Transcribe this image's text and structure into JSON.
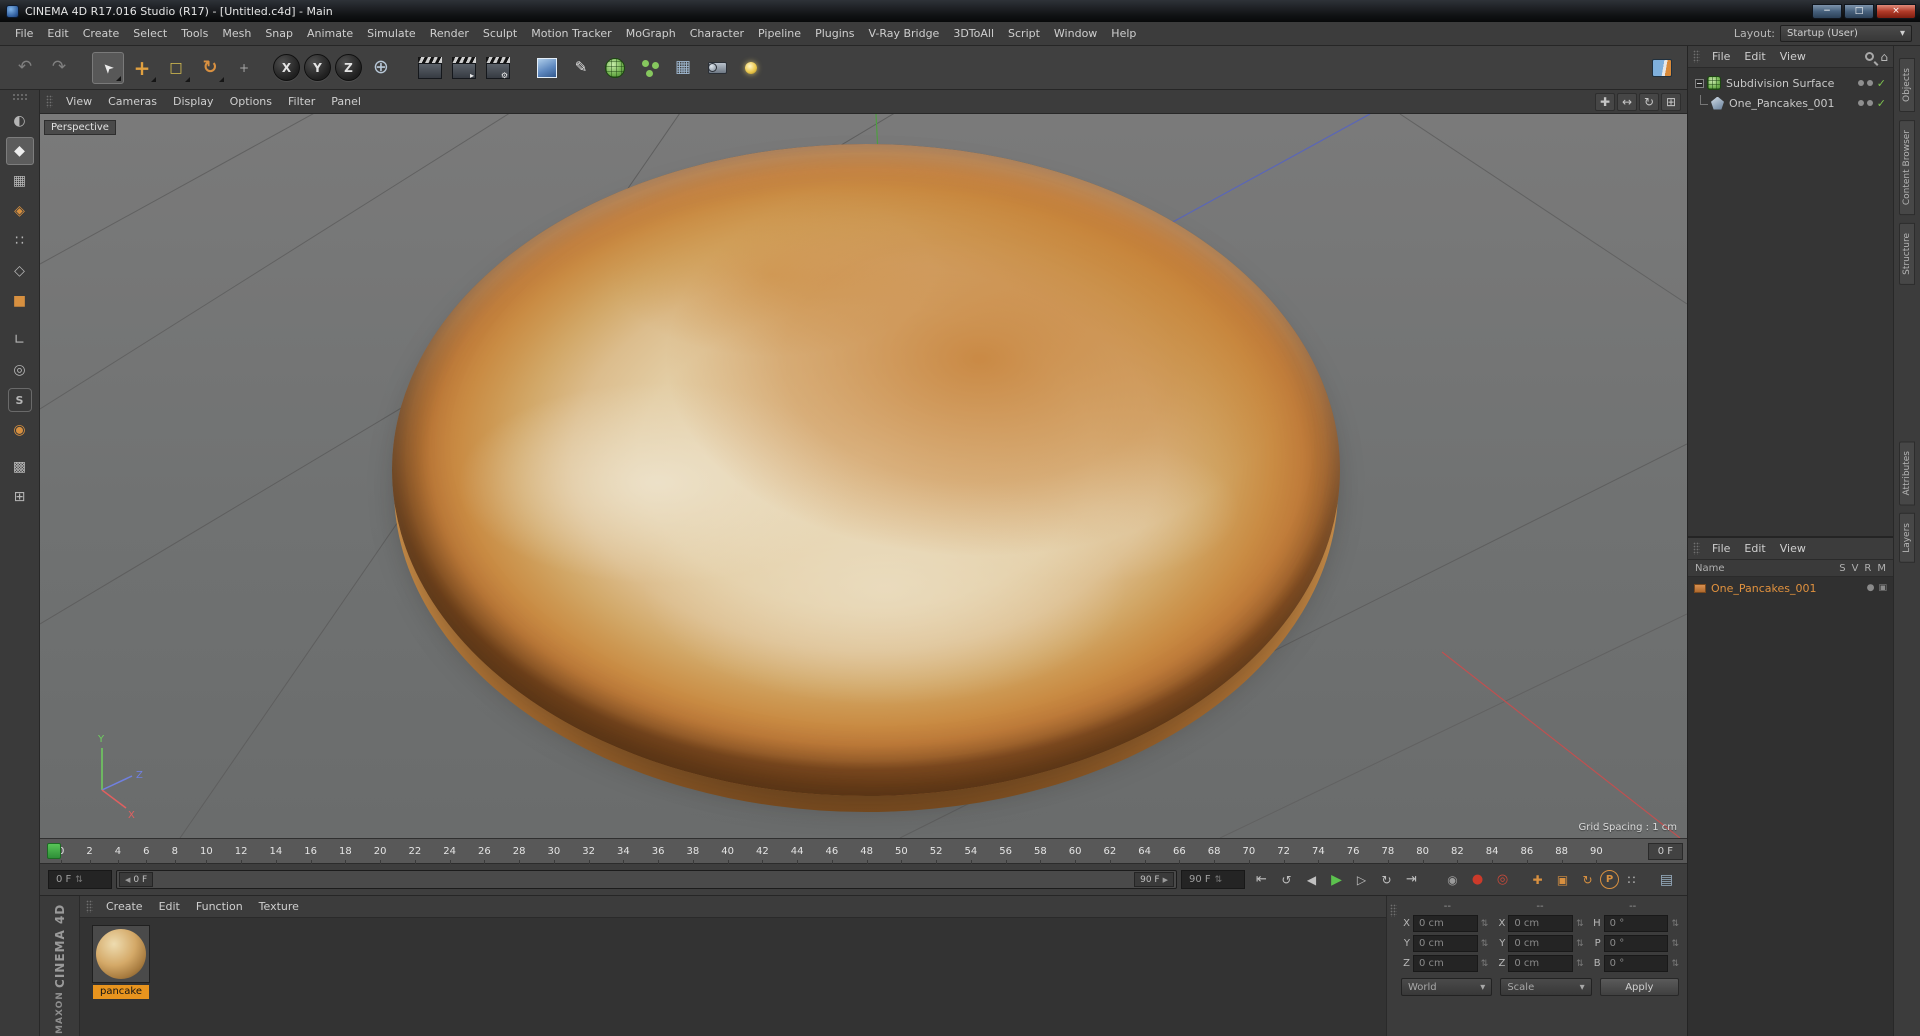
{
  "window": {
    "title": "CINEMA 4D R17.016 Studio (R17) - [Untitled.c4d] - Main",
    "controls": [
      {
        "name": "minimize-window",
        "glyph": "−"
      },
      {
        "name": "maximize-window",
        "glyph": "□"
      },
      {
        "name": "close-window",
        "glyph": "×"
      }
    ]
  },
  "menubar": {
    "items": [
      "File",
      "Edit",
      "Create",
      "Select",
      "Tools",
      "Mesh",
      "Snap",
      "Animate",
      "Simulate",
      "Render",
      "Sculpt",
      "Motion Tracker",
      "MoGraph",
      "Character",
      "Pipeline",
      "Plugins",
      "V-Ray Bridge",
      "3DToAll",
      "Script",
      "Window",
      "Help"
    ],
    "layout_label": "Layout:",
    "layout_value": "Startup (User)"
  },
  "toolbar": {
    "tools": [
      {
        "name": "undo",
        "glyph": "↶"
      },
      {
        "name": "redo",
        "glyph": "↷"
      },
      {
        "name": "live-selection",
        "glyph": "➤"
      },
      {
        "name": "move-tool",
        "glyph": "+"
      },
      {
        "name": "scale-tool",
        "glyph": "□"
      },
      {
        "name": "rotate-tool",
        "glyph": "↻"
      },
      {
        "name": "last-tool",
        "glyph": "+"
      },
      {
        "name": "lock-x-axis",
        "glyph": "X"
      },
      {
        "name": "lock-y-axis",
        "glyph": "Y"
      },
      {
        "name": "lock-z-axis",
        "glyph": "Z"
      },
      {
        "name": "coordinate-system",
        "glyph": "⊕"
      },
      {
        "name": "render-view",
        "glyph": ""
      },
      {
        "name": "render-picture-viewer",
        "glyph": "▸"
      },
      {
        "name": "render-settings",
        "glyph": "⚙"
      },
      {
        "name": "add-cube",
        "glyph": ""
      },
      {
        "name": "pen-spline",
        "glyph": "✎"
      },
      {
        "name": "subdivision-surface",
        "glyph": ""
      },
      {
        "name": "array-mograph",
        "glyph": ""
      },
      {
        "name": "floor-grid",
        "glyph": "▦"
      },
      {
        "name": "camera",
        "glyph": ""
      },
      {
        "name": "light",
        "glyph": ""
      },
      {
        "name": "palette-book",
        "glyph": ""
      }
    ]
  },
  "mode_toolbar": {
    "tools": [
      {
        "name": "make-editable",
        "glyph": "◐"
      },
      {
        "name": "model-mode",
        "glyph": "◆"
      },
      {
        "name": "texture-mode",
        "glyph": "▦"
      },
      {
        "name": "workplane-mode",
        "glyph": "◈"
      },
      {
        "name": "points-mode",
        "glyph": "∷"
      },
      {
        "name": "edges-mode",
        "glyph": "◇"
      },
      {
        "name": "polygons-mode",
        "glyph": "■"
      },
      {
        "name": "axis-mode",
        "glyph": "∟"
      },
      {
        "name": "tweak-mode",
        "glyph": "◎"
      },
      {
        "name": "snap-toggle",
        "glyph": "S"
      },
      {
        "name": "quantize-toggle",
        "glyph": "◉"
      },
      {
        "name": "lock-workplane",
        "glyph": "▩"
      },
      {
        "name": "workplane-align",
        "glyph": "⊞"
      }
    ]
  },
  "viewport": {
    "menu": [
      "View",
      "Cameras",
      "Display",
      "Options",
      "Filter",
      "Panel"
    ],
    "nav_tools": [
      {
        "name": "pan-view",
        "glyph": "✚"
      },
      {
        "name": "zoom-view",
        "glyph": "↔"
      },
      {
        "name": "rotate-view",
        "glyph": "↻"
      },
      {
        "name": "toggle-view",
        "glyph": "⊞"
      }
    ],
    "camera_label": "Perspective",
    "grid_spacing_label": "Grid Spacing : 1 cm",
    "axis": {
      "x": "X",
      "y": "Y",
      "z": "Z"
    }
  },
  "timeline": {
    "ticks": [
      "0",
      "2",
      "4",
      "6",
      "8",
      "10",
      "12",
      "14",
      "16",
      "18",
      "20",
      "22",
      "24",
      "26",
      "28",
      "30",
      "32",
      "34",
      "36",
      "38",
      "40",
      "42",
      "44",
      "46",
      "48",
      "50",
      "52",
      "54",
      "56",
      "58",
      "60",
      "62",
      "64",
      "66",
      "68",
      "70",
      "72",
      "74",
      "76",
      "78",
      "80",
      "82",
      "84",
      "86",
      "88",
      "90"
    ],
    "current_frame": "0 F"
  },
  "transport": {
    "range_start": "0 F",
    "range_end": "90 F",
    "slider_left_label": "0 F",
    "slider_right_label": "90 F",
    "buttons": [
      {
        "name": "goto-start",
        "glyph": "⇤"
      },
      {
        "name": "play-backwards",
        "glyph": "↺"
      },
      {
        "name": "previous-frame",
        "glyph": "◀"
      },
      {
        "name": "play-forwards",
        "glyph": "▶"
      },
      {
        "name": "next-frame",
        "glyph": "▷"
      },
      {
        "name": "loop",
        "glyph": "↻"
      },
      {
        "name": "goto-end",
        "glyph": "⇥"
      },
      {
        "name": "record-objects",
        "glyph": "◉"
      },
      {
        "name": "autokey",
        "glyph": "●"
      },
      {
        "name": "keyframe-selection",
        "glyph": "◎"
      },
      {
        "name": "record-position",
        "glyph": "✚"
      },
      {
        "name": "record-scale",
        "glyph": "▣"
      },
      {
        "name": "record-rotation",
        "glyph": "↻"
      },
      {
        "name": "record-parameter",
        "glyph": "P"
      },
      {
        "name": "record-pla",
        "glyph": "∷"
      },
      {
        "name": "minimal-maximal",
        "glyph": "▤"
      }
    ]
  },
  "materials_panel": {
    "menu": [
      "Create",
      "Edit",
      "Function",
      "Texture"
    ],
    "materials": [
      {
        "label": "pancake"
      }
    ]
  },
  "coordinates": {
    "headers": [
      "--",
      "--",
      "--"
    ],
    "rows": [
      {
        "c1_label": "X",
        "c1_value": "0 cm",
        "c2_label": "X",
        "c2_value": "0 cm",
        "c3_label": "H",
        "c3_value": "0 °"
      },
      {
        "c1_label": "Y",
        "c1_value": "0 cm",
        "c2_label": "Y",
        "c2_value": "0 cm",
        "c3_label": "P",
        "c3_value": "0 °"
      },
      {
        "c1_label": "Z",
        "c1_value": "0 cm",
        "c2_label": "Z",
        "c2_value": "0 cm",
        "c3_label": "B",
        "c3_value": "0 °"
      }
    ],
    "mode_select": "World",
    "scale_select": "Scale",
    "apply_button": "Apply"
  },
  "object_manager": {
    "menu": [
      "File",
      "Edit",
      "View"
    ],
    "objects": [
      {
        "label": "Subdivision Surface"
      },
      {
        "label": "One_Pancakes_001"
      }
    ]
  },
  "layer_manager": {
    "menu": [
      "File",
      "Edit",
      "View"
    ],
    "name_header": "Name",
    "columns": [
      "S",
      "V",
      "R",
      "M"
    ],
    "rows": [
      {
        "label": "One_Pancakes_001"
      }
    ]
  },
  "side_tabs": {
    "top": [
      "Objects",
      "Content Browser",
      "Structure"
    ],
    "bottom": [
      "Attributes",
      "Layers"
    ]
  },
  "branding": {
    "maxon": "MAXON",
    "cinema": "CINEMA 4D"
  },
  "ui": {
    "stepper": "⇅",
    "dropdown": "▾",
    "check": "✓",
    "home": "⌂",
    "slider_left": "◀",
    "slider_right": "▶",
    "dot": "●",
    "box_icon": "▣"
  }
}
